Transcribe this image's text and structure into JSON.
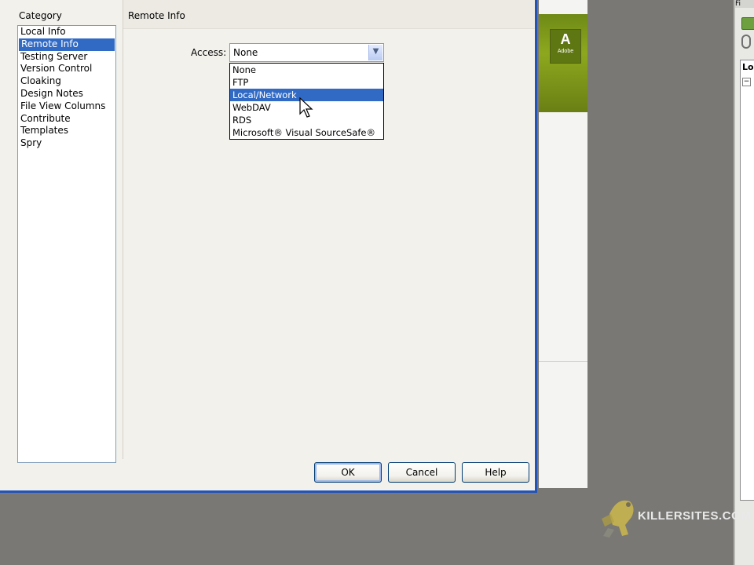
{
  "dialog": {
    "category_header": "Category",
    "categories": [
      {
        "label": "Local Info",
        "selected": false
      },
      {
        "label": "Remote Info",
        "selected": true
      },
      {
        "label": "Testing Server",
        "selected": false
      },
      {
        "label": "Version Control",
        "selected": false
      },
      {
        "label": "Cloaking",
        "selected": false
      },
      {
        "label": "Design Notes",
        "selected": false
      },
      {
        "label": "File View Columns",
        "selected": false
      },
      {
        "label": "Contribute",
        "selected": false
      },
      {
        "label": "Templates",
        "selected": false
      },
      {
        "label": "Spry",
        "selected": false
      }
    ],
    "panel_title": "Remote Info",
    "access_label": "Access:",
    "access_value": "None",
    "access_options": [
      {
        "label": "None",
        "highlighted": false
      },
      {
        "label": "FTP",
        "highlighted": false
      },
      {
        "label": "Local/Network",
        "highlighted": true
      },
      {
        "label": "WebDAV",
        "highlighted": false
      },
      {
        "label": "RDS",
        "highlighted": false
      },
      {
        "label": "Microsoft® Visual SourceSafe®",
        "highlighted": false
      }
    ],
    "buttons": {
      "ok": "OK",
      "cancel": "Cancel",
      "help": "Help"
    }
  },
  "background": {
    "logo_letter": "A",
    "logo_text": "Adobe",
    "panel_label": "Loc",
    "panel_top_label": "Fi"
  },
  "watermark": {
    "text": "KILLERSITES.COM"
  },
  "colors": {
    "selection": "#316ac5",
    "dialog_border": "#2253b8",
    "logo_green": "#6f8a16"
  }
}
